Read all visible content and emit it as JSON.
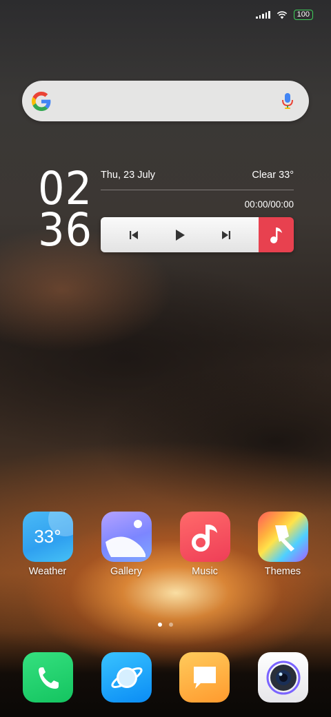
{
  "status_bar": {
    "battery": "100"
  },
  "search": {
    "placeholder": ""
  },
  "clock": {
    "hours": "02",
    "minutes": "36"
  },
  "widget": {
    "date": "Thu, 23 July",
    "weather": "Clear 33°",
    "track_time": "00:00/00:00"
  },
  "apps": [
    {
      "label": "Weather",
      "icon": "weather-icon",
      "temp": "33°"
    },
    {
      "label": "Gallery",
      "icon": "gallery-icon"
    },
    {
      "label": "Music",
      "icon": "music-icon"
    },
    {
      "label": "Themes",
      "icon": "themes-icon"
    }
  ],
  "dock": [
    "phone-icon",
    "browser-icon",
    "messages-icon",
    "camera-icon"
  ],
  "pages": {
    "count": 2,
    "active": 1
  },
  "colors": {
    "battery_border": "#3ed05a",
    "music_accent": "#e8414f"
  }
}
